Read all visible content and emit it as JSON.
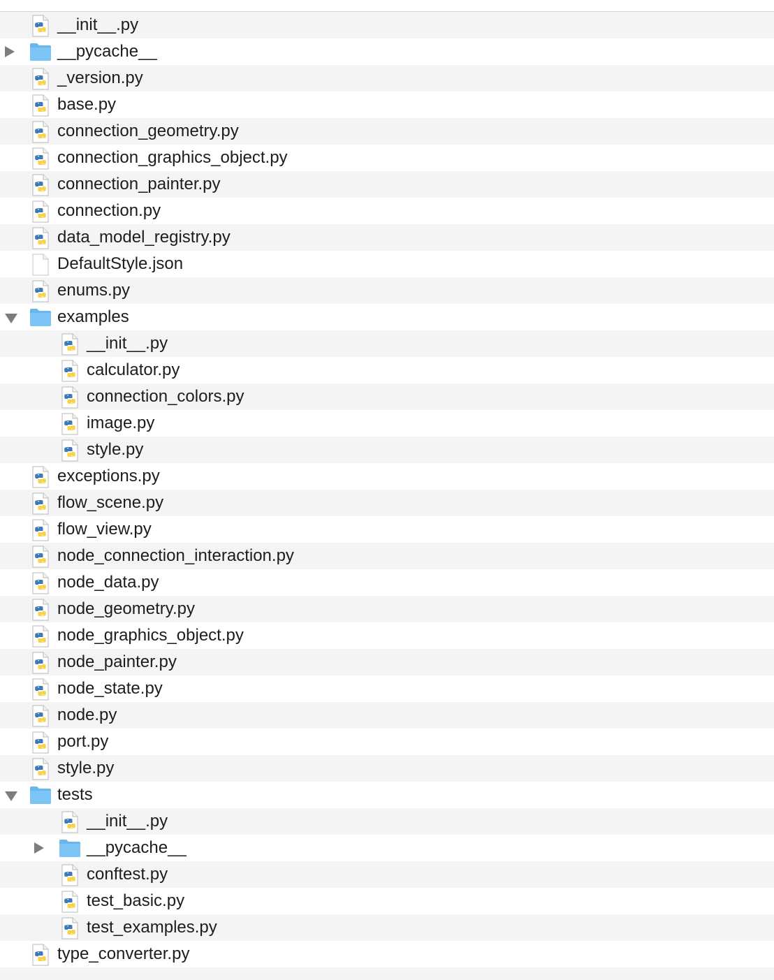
{
  "tree": {
    "rows": [
      {
        "name": "__init__.py",
        "kind": "py",
        "depth": 0
      },
      {
        "name": "__pycache__",
        "kind": "folder",
        "depth": 0,
        "state": "collapsed"
      },
      {
        "name": "_version.py",
        "kind": "py",
        "depth": 0
      },
      {
        "name": "base.py",
        "kind": "py",
        "depth": 0
      },
      {
        "name": "connection_geometry.py",
        "kind": "py",
        "depth": 0
      },
      {
        "name": "connection_graphics_object.py",
        "kind": "py",
        "depth": 0
      },
      {
        "name": "connection_painter.py",
        "kind": "py",
        "depth": 0
      },
      {
        "name": "connection.py",
        "kind": "py",
        "depth": 0
      },
      {
        "name": "data_model_registry.py",
        "kind": "py",
        "depth": 0
      },
      {
        "name": "DefaultStyle.json",
        "kind": "json",
        "depth": 0
      },
      {
        "name": "enums.py",
        "kind": "py",
        "depth": 0
      },
      {
        "name": "examples",
        "kind": "folder",
        "depth": 0,
        "state": "expanded"
      },
      {
        "name": "__init__.py",
        "kind": "py",
        "depth": 1
      },
      {
        "name": "calculator.py",
        "kind": "py",
        "depth": 1
      },
      {
        "name": "connection_colors.py",
        "kind": "py",
        "depth": 1
      },
      {
        "name": "image.py",
        "kind": "py",
        "depth": 1
      },
      {
        "name": "style.py",
        "kind": "py",
        "depth": 1
      },
      {
        "name": "exceptions.py",
        "kind": "py",
        "depth": 0
      },
      {
        "name": "flow_scene.py",
        "kind": "py",
        "depth": 0
      },
      {
        "name": "flow_view.py",
        "kind": "py",
        "depth": 0
      },
      {
        "name": "node_connection_interaction.py",
        "kind": "py",
        "depth": 0
      },
      {
        "name": "node_data.py",
        "kind": "py",
        "depth": 0
      },
      {
        "name": "node_geometry.py",
        "kind": "py",
        "depth": 0
      },
      {
        "name": "node_graphics_object.py",
        "kind": "py",
        "depth": 0
      },
      {
        "name": "node_painter.py",
        "kind": "py",
        "depth": 0
      },
      {
        "name": "node_state.py",
        "kind": "py",
        "depth": 0
      },
      {
        "name": "node.py",
        "kind": "py",
        "depth": 0
      },
      {
        "name": "port.py",
        "kind": "py",
        "depth": 0
      },
      {
        "name": "style.py",
        "kind": "py",
        "depth": 0
      },
      {
        "name": "tests",
        "kind": "folder",
        "depth": 0,
        "state": "expanded"
      },
      {
        "name": "__init__.py",
        "kind": "py",
        "depth": 1
      },
      {
        "name": "__pycache__",
        "kind": "folder",
        "depth": 1,
        "state": "collapsed"
      },
      {
        "name": "conftest.py",
        "kind": "py",
        "depth": 1
      },
      {
        "name": "test_basic.py",
        "kind": "py",
        "depth": 1
      },
      {
        "name": "test_examples.py",
        "kind": "py",
        "depth": 1
      },
      {
        "name": "type_converter.py",
        "kind": "py",
        "depth": 0
      }
    ]
  },
  "icons": {
    "py": "python-file-icon",
    "json": "document-file-icon",
    "folder": "folder-icon"
  },
  "colors": {
    "folder": "#7cc4f5",
    "row_alt": "#f4f4f4",
    "python_blue": "#3d7ab8",
    "python_yellow": "#f7d44a",
    "disclosure": "#7d7d7d"
  }
}
